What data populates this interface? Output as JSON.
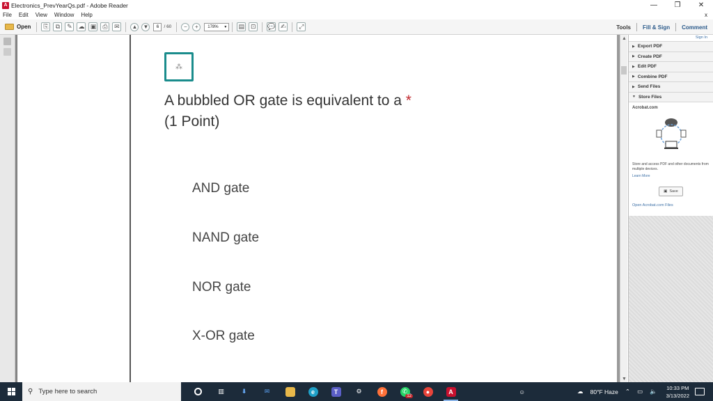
{
  "window": {
    "title": "Electronics_PrevYearQs.pdf - Adobe Reader",
    "minimize": "—",
    "restore": "❐",
    "close": "✕"
  },
  "menu": {
    "items": [
      "File",
      "Edit",
      "View",
      "Window",
      "Help"
    ],
    "doc_close": "x"
  },
  "toolbar": {
    "open_label": "Open",
    "page_current": "6",
    "page_total": "/ 60",
    "zoom": "178%",
    "tools_label": "Tools",
    "fill_sign_label": "Fill & Sign",
    "comment_label": "Comment"
  },
  "document": {
    "question": "A bubbled OR gate is equivalent to a",
    "required_mark": "*",
    "points": "(1 Point)",
    "options": [
      "AND gate",
      "NAND gate",
      "NOR gate",
      "X-OR gate"
    ]
  },
  "right_panel": {
    "sign_in": "Sign In",
    "items": [
      {
        "label": "Export PDF",
        "expanded": false
      },
      {
        "label": "Create PDF",
        "expanded": false
      },
      {
        "label": "Edit PDF",
        "expanded": false
      },
      {
        "label": "Combine PDF",
        "expanded": false
      },
      {
        "label": "Send Files",
        "expanded": false
      },
      {
        "label": "Store Files",
        "expanded": true
      }
    ],
    "store": {
      "title": "Acrobat.com",
      "description": "Store and access PDF and other documents from multiple devices.",
      "learn_more": "Learn More",
      "save_label": "Save",
      "open_files": "Open Acrobat.com Files"
    }
  },
  "taskbar": {
    "search_placeholder": "Type here to search",
    "weather": "80°F Haze",
    "time": "10:33 PM",
    "date": "3/13/2022",
    "whatsapp_badge": "12"
  },
  "colors": {
    "accent_teal": "#1a8c8c",
    "required_red": "#c1272d",
    "taskbar_bg": "#1c2b3a",
    "link_blue": "#3a6ea5"
  }
}
